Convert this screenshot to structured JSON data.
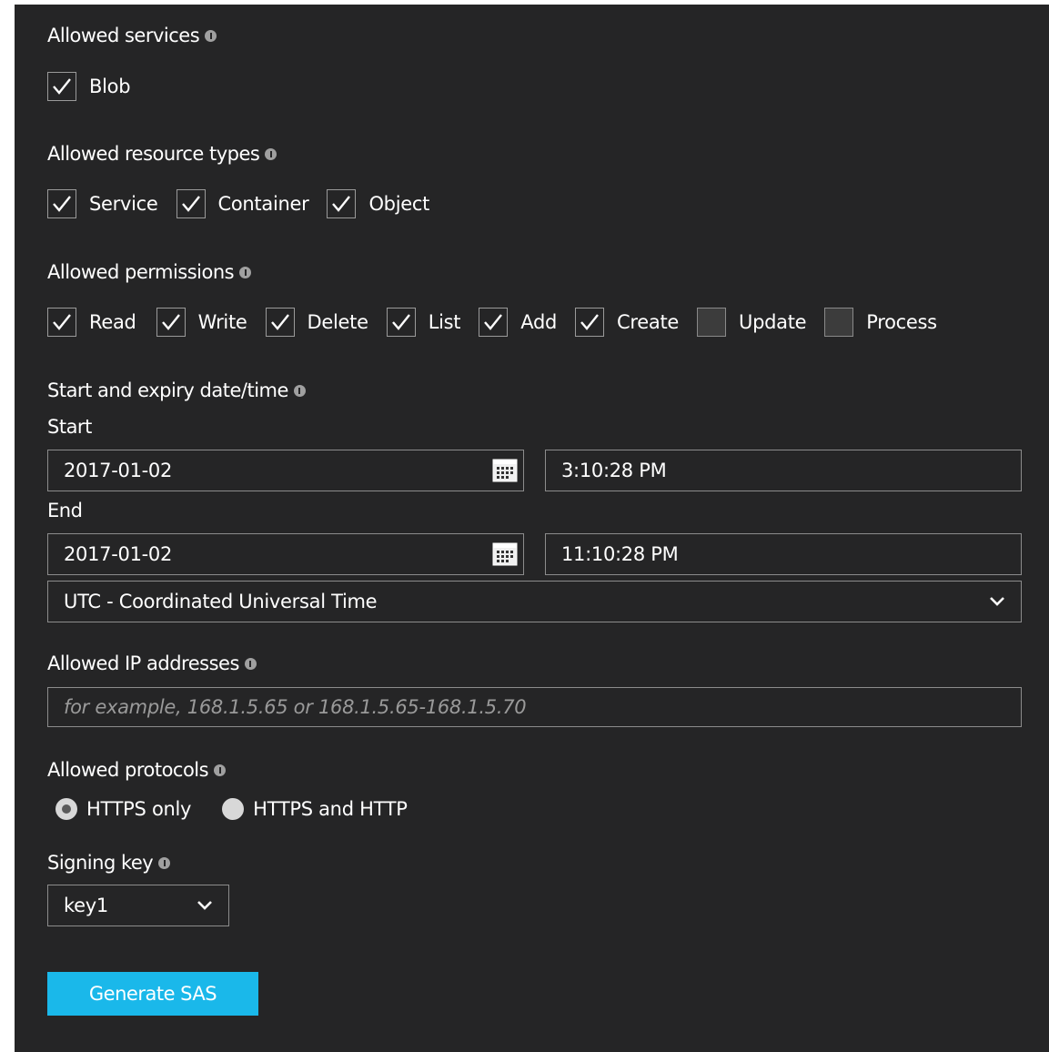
{
  "allowed_services": {
    "label": "Allowed services",
    "options": [
      {
        "label": "Blob",
        "checked": true
      }
    ]
  },
  "allowed_resource_types": {
    "label": "Allowed resource types",
    "options": [
      {
        "label": "Service",
        "checked": true
      },
      {
        "label": "Container",
        "checked": true
      },
      {
        "label": "Object",
        "checked": true
      }
    ]
  },
  "allowed_permissions": {
    "label": "Allowed permissions",
    "options": [
      {
        "label": "Read",
        "checked": true
      },
      {
        "label": "Write",
        "checked": true
      },
      {
        "label": "Delete",
        "checked": true
      },
      {
        "label": "List",
        "checked": true
      },
      {
        "label": "Add",
        "checked": true
      },
      {
        "label": "Create",
        "checked": true
      },
      {
        "label": "Update",
        "checked": false
      },
      {
        "label": "Process",
        "checked": false
      }
    ]
  },
  "datetime": {
    "label": "Start and expiry date/time",
    "start_label": "Start",
    "start_date": "2017-01-02",
    "start_time": "3:10:28 PM",
    "end_label": "End",
    "end_date": "2017-01-02",
    "end_time": "11:10:28 PM",
    "timezone": "UTC - Coordinated Universal Time"
  },
  "allowed_ip": {
    "label": "Allowed IP addresses",
    "placeholder": "for example, 168.1.5.65 or 168.1.5.65-168.1.5.70",
    "value": ""
  },
  "allowed_protocols": {
    "label": "Allowed protocols",
    "options": [
      {
        "label": "HTTPS only",
        "selected": true
      },
      {
        "label": "HTTPS and HTTP",
        "selected": false
      }
    ]
  },
  "signing_key": {
    "label": "Signing key",
    "value": "key1"
  },
  "generate_button": {
    "label": "Generate SAS"
  },
  "colors": {
    "background": "#252526",
    "accent": "#1ab8ea",
    "border": "#8c8c8c",
    "text": "#ffffff",
    "placeholder": "#9a9a9a"
  },
  "icons": {
    "info": "info-icon",
    "calendar": "calendar-icon",
    "chevron": "chevron-down-icon",
    "check": "check-icon"
  }
}
